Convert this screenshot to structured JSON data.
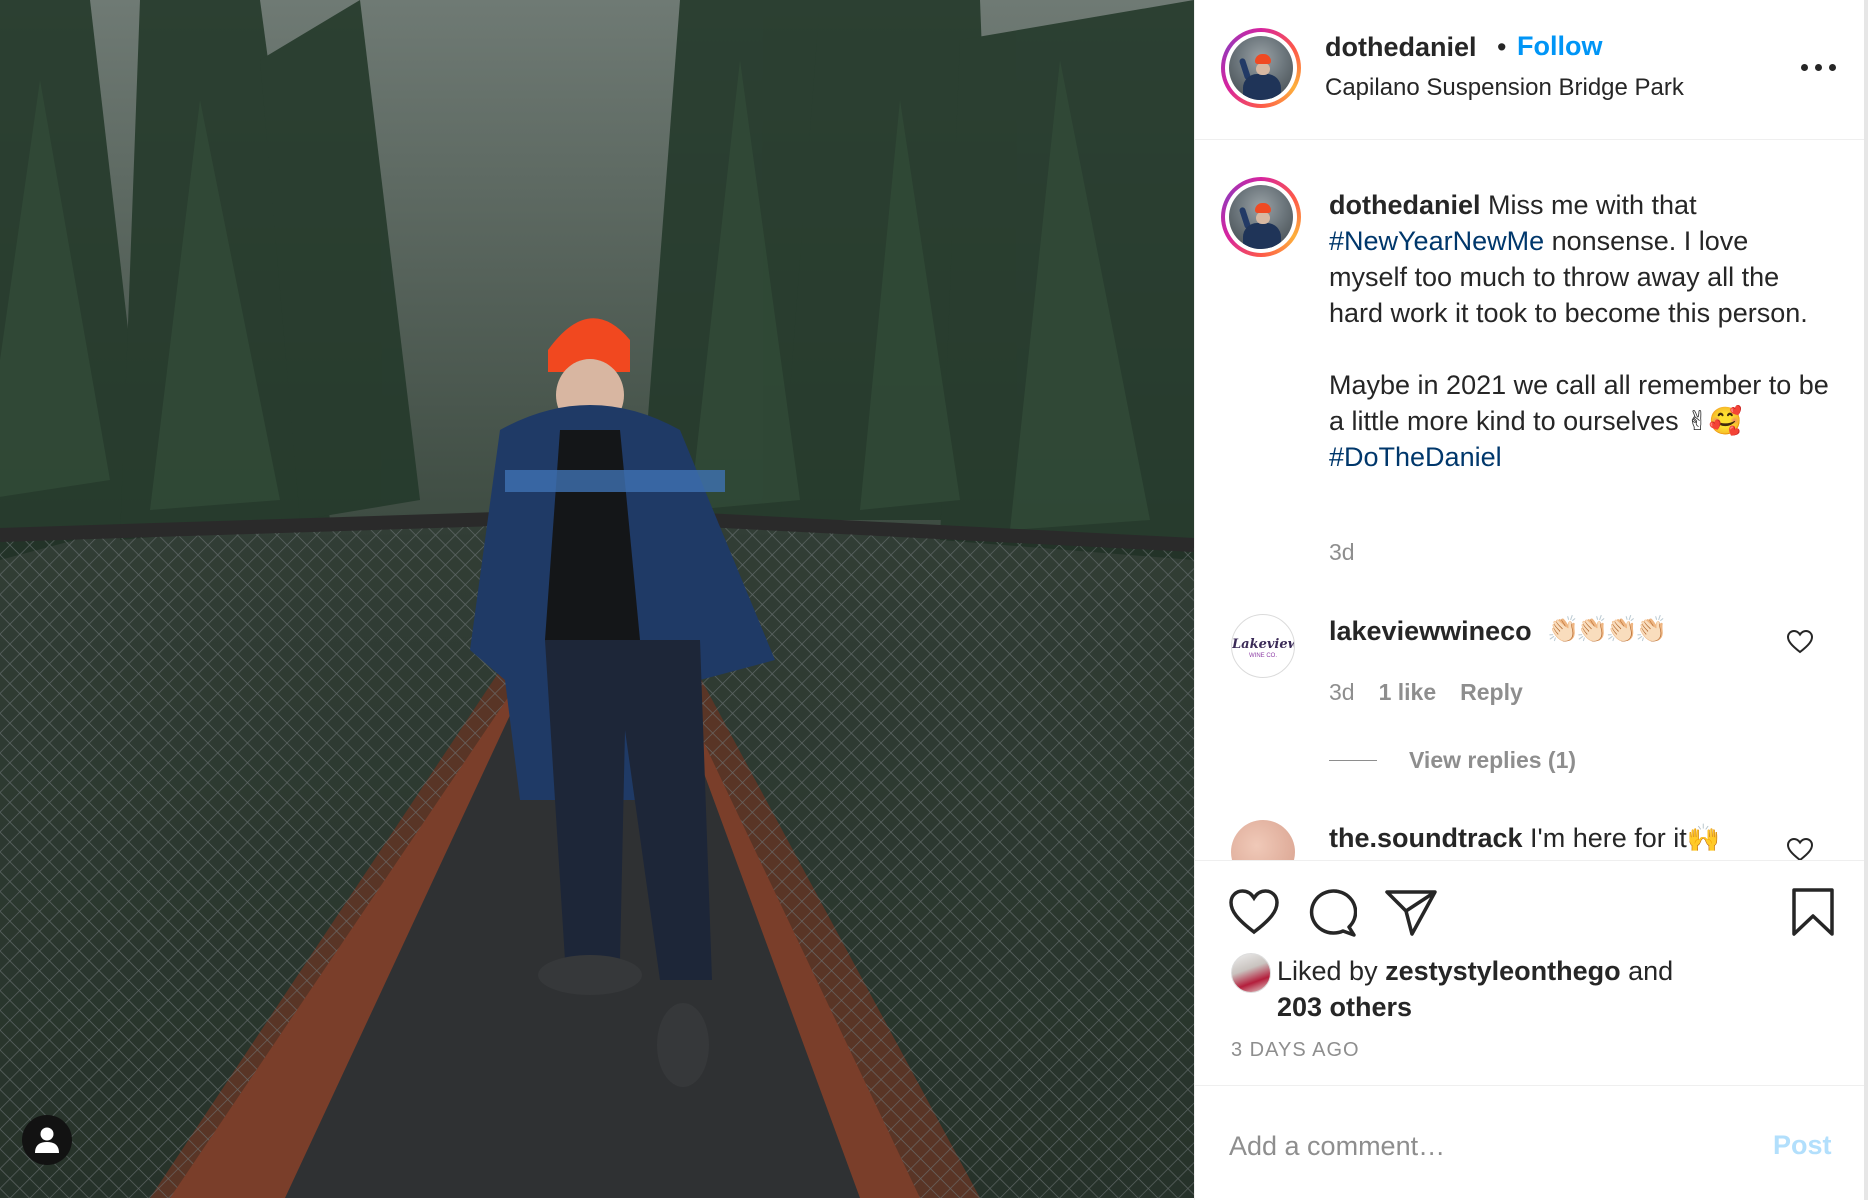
{
  "post": {
    "photo_icon": "user-tag-icon",
    "username": "dothedaniel",
    "separator": "•",
    "follow_label": "Follow",
    "location": "Capilano Suspension Bridge Park",
    "more_icon": "more-options-icon"
  },
  "caption": {
    "username": "dothedaniel",
    "text_1": " Miss me with that ",
    "hashtag_1": "#NewYearNewMe",
    "text_2": " nonsense. I love myself too much to throw away all the hard work it took to become this person.\n\nMaybe in 2021 we call all remember to be a little more kind to ourselves ✌🥰 ",
    "hashtag_2": "#DoTheDaniel",
    "time": "3d"
  },
  "comments": [
    {
      "username": "lakeviewwineco",
      "avatar_text": "Lakeview",
      "avatar_subtext": "WINE CO.",
      "text": "👏🏻👏🏻👏🏻👏🏻",
      "time": "3d",
      "likes": "1 like",
      "reply_label": "Reply",
      "view_replies": "View replies (1)"
    },
    {
      "username": "the.soundtrack",
      "text": " I'm here for it🙌"
    }
  ],
  "actions": {
    "like_icon": "heart-icon",
    "comment_icon": "comment-icon",
    "share_icon": "send-icon",
    "save_icon": "bookmark-icon"
  },
  "likes": {
    "prefix": "Liked by ",
    "user": "zestystyleonthego",
    "mid": " and",
    "others": "203 others"
  },
  "timestamp": "3 DAYS AGO",
  "add_comment": {
    "placeholder": "Add a comment…",
    "post_label": "Post"
  },
  "colors": {
    "link_blue": "#0095f6",
    "hashtag": "#00376b",
    "muted": "#8e8e8e",
    "post_disabled": "#b2dffc"
  }
}
